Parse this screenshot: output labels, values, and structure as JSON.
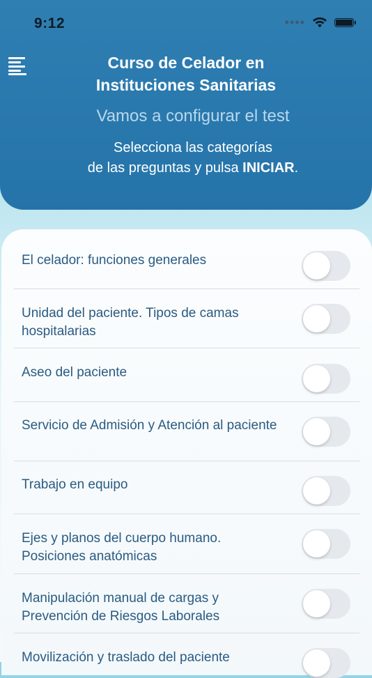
{
  "status_bar": {
    "time": "9:12"
  },
  "header": {
    "title_line1": "Curso de Celador en",
    "title_line2": "Instituciones Sanitarias",
    "subtitle": "Vamos a configurar el test",
    "instructions_line1": "Selecciona las categorías",
    "instructions_line2_prefix": "de las preguntas y pulsa ",
    "instructions_line2_bold": "INICIAR",
    "instructions_line2_suffix": "."
  },
  "categories": [
    {
      "label": "El celador: funciones generales",
      "enabled": false
    },
    {
      "label": "Unidad del paciente. Tipos de camas hospitalarias",
      "enabled": false
    },
    {
      "label": "Aseo del paciente",
      "enabled": false
    },
    {
      "label": "Servicio de Admisión y Atención al paciente",
      "enabled": false
    },
    {
      "label": "Trabajo en equipo",
      "enabled": false
    },
    {
      "label": "Ejes y planos del cuerpo humano. Posiciones anatómicas",
      "enabled": false
    },
    {
      "label": "Manipulación manual de cargas y Prevención de Riesgos Laborales",
      "enabled": false
    },
    {
      "label": "Movilización y traslado del paciente",
      "enabled": false
    }
  ]
}
